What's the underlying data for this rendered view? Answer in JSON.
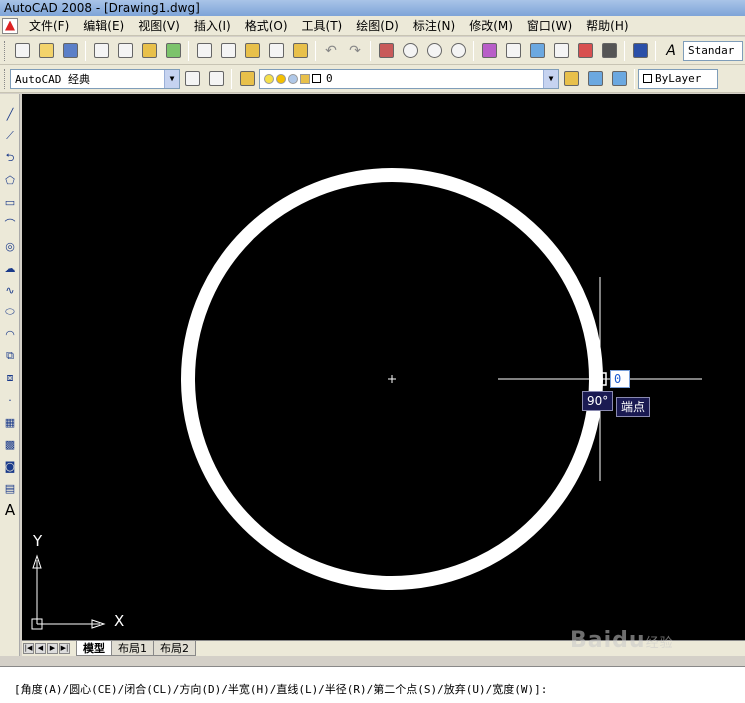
{
  "window": {
    "title": "AutoCAD 2008 - [Drawing1.dwg]"
  },
  "menu": [
    "文件(F)",
    "编辑(E)",
    "视图(V)",
    "插入(I)",
    "格式(O)",
    "工具(T)",
    "绘图(D)",
    "标注(N)",
    "修改(M)",
    "窗口(W)",
    "帮助(H)"
  ],
  "toolbar": {
    "text_style": "Standar",
    "workspace": "AutoCAD 经典",
    "layer": "0",
    "color": "ByLayer"
  },
  "canvas": {
    "background": "#000000",
    "ucs_x": "X",
    "ucs_y": "Y",
    "angle_tooltip": "90°",
    "osnap_tooltip": "端点",
    "input_value": "0"
  },
  "tabs": [
    "模型",
    "布局1",
    "布局2"
  ],
  "command": "[角度(A)/圆心(CE)/闭合(CL)/方向(D)/半宽(H)/直线(L)/半径(R)/第二个点(S)/放弃(U)/宽度(W)]:",
  "watermark": {
    "text": "Baidu",
    "suffix": "经验"
  }
}
